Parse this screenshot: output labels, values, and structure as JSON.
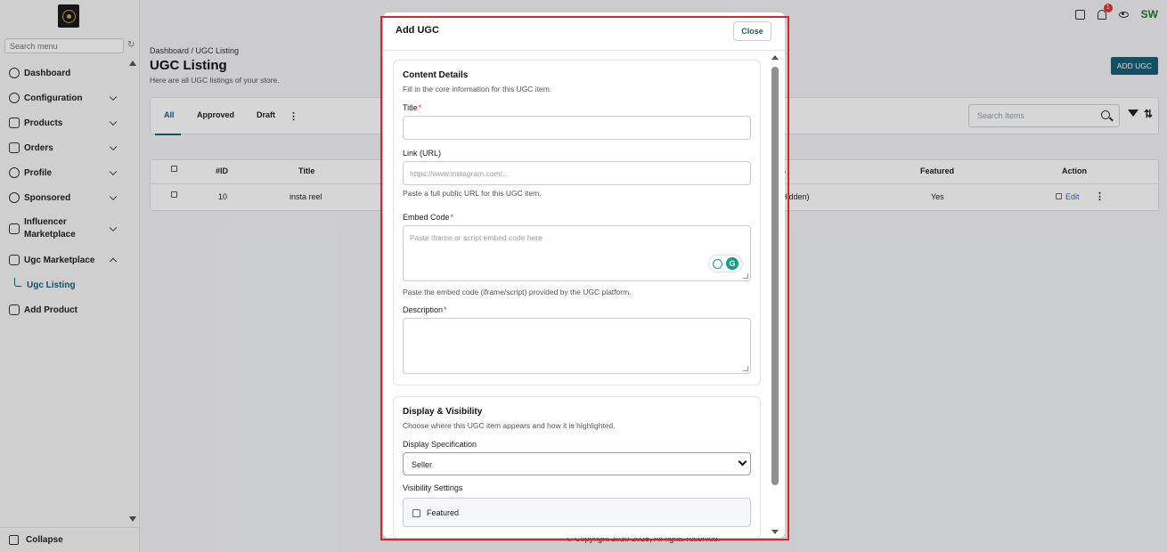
{
  "sidebar": {
    "search_placeholder": "Search menu",
    "items": [
      {
        "label": "Dashboard"
      },
      {
        "label": "Configuration"
      },
      {
        "label": "Products"
      },
      {
        "label": "Orders"
      },
      {
        "label": "Profile"
      },
      {
        "label": "Sponsored"
      },
      {
        "label": "Influencer Marketplace"
      },
      {
        "label": "Ugc Marketplace"
      },
      {
        "label": "Ugc Listing"
      },
      {
        "label": "Add Product"
      }
    ],
    "collapse_label": "Collapse"
  },
  "topbar": {
    "notification_count": "1",
    "user_initials": "SW"
  },
  "page": {
    "breadcrumb": "Dashboard / UGC Listing",
    "title": "UGC Listing",
    "subtitle": "Here are all UGC listings of your store.",
    "add_button": "ADD UGC",
    "tabs": [
      "All",
      "Approved",
      "Draft"
    ],
    "search_placeholder": "Search Items",
    "table": {
      "headers": {
        "id": "#ID",
        "title": "Title",
        "status_partial": "s",
        "featured": "Featured",
        "action": "Action"
      },
      "rows": [
        {
          "id": "10",
          "title": "insta reel",
          "status_partial": "Hidden)",
          "featured": "Yes",
          "edit": "Edit"
        }
      ]
    },
    "footer": "© Copyright 2020-2025, All rights reserved."
  },
  "modal": {
    "title": "Add UGC",
    "close_label": "Close",
    "content_details": {
      "title": "Content Details",
      "subtitle": "Fill in the core information for this UGC item.",
      "title_label": "Title",
      "link_label": "Link (URL)",
      "link_placeholder": "https://www.instagram.com/...",
      "link_help": "Paste a full public URL for this UGC item.",
      "embed_label": "Embed Code",
      "embed_placeholder": "Paste iframe or script embed code here",
      "embed_help": "Paste the embed code (iframe/script) provided by the UGC platform.",
      "description_label": "Description",
      "required_mark": "*"
    },
    "display_visibility": {
      "title": "Display & Visibility",
      "subtitle": "Choose where this UGC item appears and how it is highlighted.",
      "spec_label": "Display Specification",
      "spec_value": "Seller",
      "visibility_label": "Visibility Settings",
      "featured_label": "Featured"
    }
  },
  "colors": {
    "accent": "#17607a",
    "required": "#d9262c",
    "highlight_frame": "#d9262c"
  }
}
